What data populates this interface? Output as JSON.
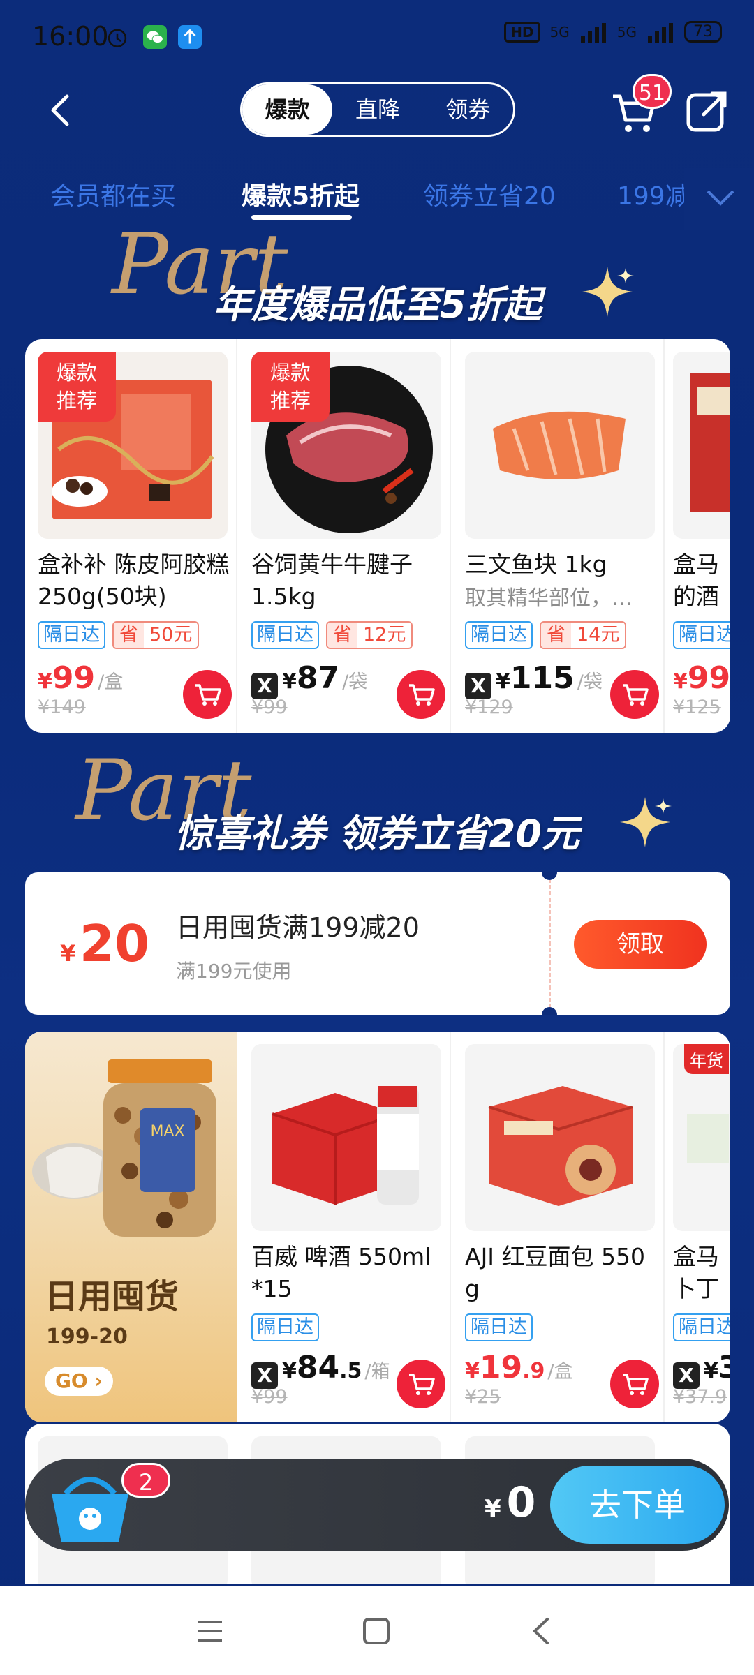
{
  "status": {
    "time": "16:00",
    "hd": "HD",
    "net1": "5G",
    "net2": "5G",
    "battery": "73"
  },
  "header": {
    "segments": [
      "爆款",
      "直降",
      "领券"
    ],
    "active_segment": 0,
    "cart_count": "51"
  },
  "tabs": [
    "会员都在买",
    "爆款5折起",
    "领券立省20",
    "199减"
  ],
  "section1": {
    "part": "Part",
    "title": "年度爆品低至5折起"
  },
  "products_row1": [
    {
      "tag": "爆款\n推荐",
      "tag1": "爆款",
      "tag2": "推荐",
      "name": "盒补补 陈皮阿胶糕 250g(50块)",
      "badge_blue": "隔日达",
      "badge_save_l": "省",
      "badge_save_r": "50元",
      "price_cur": "¥",
      "price": "99",
      "unit": "/盒",
      "orig": "¥149"
    },
    {
      "tag1": "爆款",
      "tag2": "推荐",
      "name": "谷饲黄牛牛腱子 1.5kg",
      "badge_blue": "隔日达",
      "badge_save_l": "省",
      "badge_save_r": "12元",
      "price_cur": "¥",
      "price": "87",
      "unit": "/袋",
      "orig": "¥99"
    },
    {
      "name": "三文鱼块 1kg",
      "desc": "取其精华部位，…",
      "badge_blue": "隔日达",
      "badge_save_l": "省",
      "badge_save_r": "14元",
      "price_cur": "¥",
      "price": "115",
      "unit": "/袋",
      "orig": "¥129"
    },
    {
      "name": "盒马 的酒",
      "badge_blue": "隔日达",
      "price_cur": "¥",
      "price": "99",
      "orig": "¥125"
    }
  ],
  "section2": {
    "part": "Part",
    "title": "惊喜礼券 领券立省20元"
  },
  "coupon": {
    "cur": "¥",
    "amount": "20",
    "title": "日用囤货满199减20",
    "sub": "满199元使用",
    "button": "领取"
  },
  "promo": {
    "title": "日用囤货",
    "sub": "199-20",
    "go": "GO"
  },
  "products_row2": [
    {
      "name": "百威 啤酒 550ml *15",
      "badge_blue": "隔日达",
      "price_cur": "¥",
      "price_int": "84",
      "price_dec": ".5",
      "unit": "/箱",
      "orig": "¥99"
    },
    {
      "name": "AJI 红豆面包 550 g",
      "badge_blue": "隔日达",
      "price_cur": "¥",
      "price_int": "19",
      "price_dec": ".9",
      "unit": "/盒",
      "orig": "¥25"
    },
    {
      "name": "盒马 卜丁",
      "tag": "年货",
      "badge_blue": "隔日达",
      "price_cur": "¥",
      "price": "3",
      "orig": "¥37.9"
    }
  ],
  "cart": {
    "count": "2",
    "cur": "¥",
    "total": "0",
    "checkout": "去下单"
  }
}
